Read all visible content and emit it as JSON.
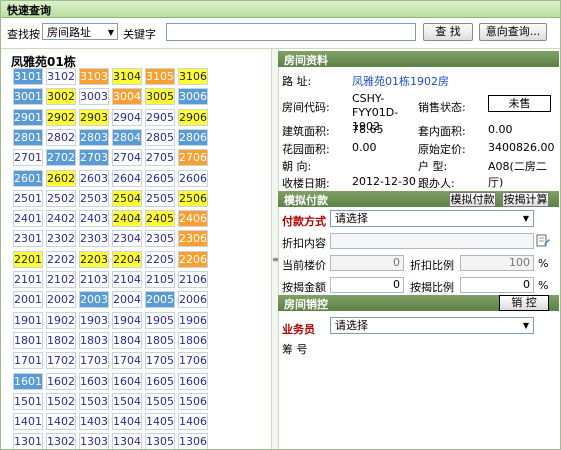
{
  "quick_search": {
    "title": "快速查询",
    "search_by_label": "查找按",
    "search_by_value": "房间路址",
    "keyword_label": "关键字",
    "keyword_value": "",
    "find_button": "查 找",
    "intent_button": "意向查询..."
  },
  "building": {
    "title": "凤雅苑01栋",
    "rows": [
      [
        [
          "3101",
          "b"
        ],
        [
          "3102",
          "w"
        ],
        [
          "3103",
          "o"
        ],
        [
          "3104",
          "y"
        ],
        [
          "3105",
          "o"
        ],
        [
          "3106",
          "y"
        ]
      ],
      [
        [
          "3001",
          "b"
        ],
        [
          "3002",
          "y"
        ],
        [
          "3003",
          "w"
        ],
        [
          "3004",
          "o"
        ],
        [
          "3005",
          "y"
        ],
        [
          "3006",
          "b"
        ]
      ],
      [
        [
          "2901",
          "b"
        ],
        [
          "2902",
          "y"
        ],
        [
          "2903",
          "y"
        ],
        [
          "2904",
          "w"
        ],
        [
          "2905",
          "w"
        ],
        [
          "2906",
          "y"
        ]
      ],
      [
        [
          "2801",
          "b"
        ],
        [
          "2802",
          "w"
        ],
        [
          "2803",
          "b"
        ],
        [
          "2804",
          "b"
        ],
        [
          "2805",
          "w"
        ],
        [
          "2806",
          "b"
        ]
      ],
      [
        [
          "2701",
          "w"
        ],
        [
          "2702",
          "b"
        ],
        [
          "2703",
          "b"
        ],
        [
          "2704",
          "w"
        ],
        [
          "2705",
          "w"
        ],
        [
          "2706",
          "o"
        ]
      ],
      [
        [
          "2601",
          "b"
        ],
        [
          "2602",
          "y"
        ],
        [
          "2603",
          "w"
        ],
        [
          "2604",
          "w"
        ],
        [
          "2605",
          "w"
        ],
        [
          "2606",
          "w"
        ]
      ],
      [
        [
          "2501",
          "w"
        ],
        [
          "2502",
          "w"
        ],
        [
          "2503",
          "w"
        ],
        [
          "2504",
          "y"
        ],
        [
          "2505",
          "w"
        ],
        [
          "2506",
          "y"
        ]
      ],
      [
        [
          "2401",
          "w"
        ],
        [
          "2402",
          "w"
        ],
        [
          "2403",
          "w"
        ],
        [
          "2404",
          "y"
        ],
        [
          "2405",
          "y"
        ],
        [
          "2406",
          "o"
        ]
      ],
      [
        [
          "2301",
          "w"
        ],
        [
          "2302",
          "w"
        ],
        [
          "2303",
          "w"
        ],
        [
          "2304",
          "w"
        ],
        [
          "2305",
          "w"
        ],
        [
          "2306",
          "o"
        ]
      ],
      [
        [
          "2201",
          "y"
        ],
        [
          "2202",
          "w"
        ],
        [
          "2203",
          "y"
        ],
        [
          "2204",
          "y"
        ],
        [
          "2205",
          "w"
        ],
        [
          "2206",
          "o"
        ]
      ],
      [
        [
          "2101",
          "w"
        ],
        [
          "2102",
          "w"
        ],
        [
          "2103",
          "w"
        ],
        [
          "2104",
          "w"
        ],
        [
          "2105",
          "w"
        ],
        [
          "2106",
          "w"
        ]
      ],
      [
        [
          "2001",
          "w"
        ],
        [
          "2002",
          "w"
        ],
        [
          "2003",
          "b"
        ],
        [
          "2004",
          "w"
        ],
        [
          "2005",
          "b"
        ],
        [
          "2006",
          "w"
        ]
      ],
      [
        [
          "1901",
          "w"
        ],
        [
          "1902",
          "w"
        ],
        [
          "1903",
          "w"
        ],
        [
          "1904",
          "w"
        ],
        [
          "1905",
          "w"
        ],
        [
          "1906",
          "w"
        ]
      ],
      [
        [
          "1801",
          "w"
        ],
        [
          "1802",
          "w"
        ],
        [
          "1803",
          "w"
        ],
        [
          "1804",
          "w"
        ],
        [
          "1805",
          "w"
        ],
        [
          "1806",
          "w"
        ]
      ],
      [
        [
          "1701",
          "w"
        ],
        [
          "1702",
          "w"
        ],
        [
          "1703",
          "w"
        ],
        [
          "1704",
          "w"
        ],
        [
          "1705",
          "w"
        ],
        [
          "1706",
          "w"
        ]
      ],
      [
        [
          "1601",
          "b"
        ],
        [
          "1602",
          "w"
        ],
        [
          "1603",
          "w"
        ],
        [
          "1604",
          "w"
        ],
        [
          "1605",
          "w"
        ],
        [
          "1606",
          "w"
        ]
      ],
      [
        [
          "1501",
          "w"
        ],
        [
          "1502",
          "w"
        ],
        [
          "1503",
          "w"
        ],
        [
          "1504",
          "w"
        ],
        [
          "1505",
          "w"
        ],
        [
          "1506",
          "w"
        ]
      ],
      [
        [
          "1401",
          "w"
        ],
        [
          "1402",
          "w"
        ],
        [
          "1403",
          "w"
        ],
        [
          "1404",
          "w"
        ],
        [
          "1405",
          "w"
        ],
        [
          "1406",
          "w"
        ]
      ],
      [
        [
          "1301",
          "w"
        ],
        [
          "1302",
          "w"
        ],
        [
          "1303",
          "w"
        ],
        [
          "1304",
          "w"
        ],
        [
          "1305",
          "w"
        ],
        [
          "1306",
          "w"
        ]
      ]
    ]
  },
  "room_info": {
    "header": "房间资料",
    "address_label": "路 址:",
    "address_value": "凤雅苑01栋1902房",
    "code_label": "房间代码:",
    "code_value": "CSHY-FYY01D-1902",
    "sales_status_label": "销售状态:",
    "sales_status_value": "未售",
    "build_area_label": "建筑面积:",
    "build_area_value": "78.65",
    "inner_area_label": "套内面积:",
    "inner_area_value": "0.00",
    "garden_area_label": "花园面积:",
    "garden_area_value": "0.00",
    "orig_price_label": "原始定价:",
    "orig_price_value": "3400826.00",
    "facing_label": "朝 向:",
    "facing_value": "",
    "layout_label": "户 型:",
    "layout_value": "A08(二房二厅)",
    "date_label": "收楼日期:",
    "date_value": "2012-12-30",
    "follower_label": "跟办人:",
    "follower_value": ""
  },
  "payment": {
    "header": "模拟付款",
    "simulate_button": "模拟付款",
    "mortgage_button": "按揭计算",
    "method_label": "付款方式",
    "method_value": "请选择",
    "discount_label": "折扣内容",
    "unit_price_label": "当前楼价",
    "unit_price_value": "0",
    "discount_rate_label": "折扣比例",
    "discount_rate_value": "100",
    "loan_amount_label": "按揭金额",
    "loan_amount_value": "0",
    "loan_rate_label": "按揭比例",
    "loan_rate_value": "0",
    "percent": "%"
  },
  "control": {
    "header": "房间销控",
    "control_button": "销 控",
    "salesperson_label": "业务员",
    "salesperson_value": "请选择",
    "chip_label": "筹 号"
  }
}
